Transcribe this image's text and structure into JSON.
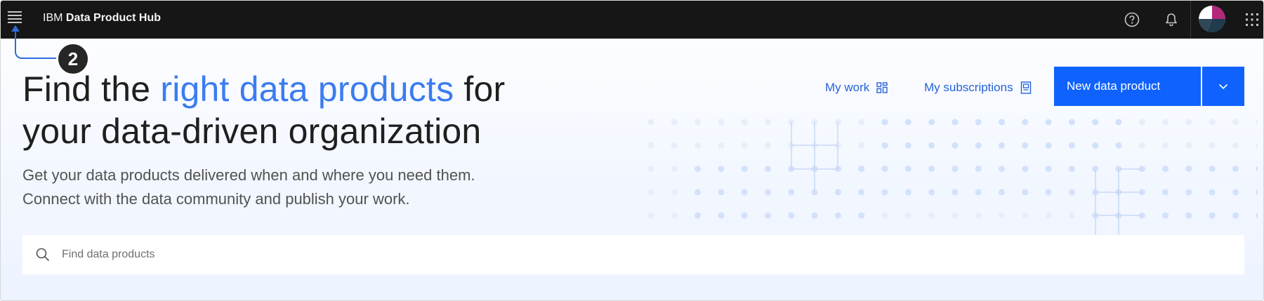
{
  "header": {
    "brand_prefix": "IBM",
    "brand_name": "Data Product Hub",
    "icons": [
      "menu-icon",
      "help-icon",
      "notification-icon",
      "avatar",
      "app-switcher-icon"
    ]
  },
  "annotation": {
    "badge": "2"
  },
  "hero": {
    "title_part1": "Find the ",
    "title_accent": "right data products",
    "title_part2": " for",
    "title_line2": "your data-driven organization",
    "subtitle_line1": "Get your data products delivered when and where you need them.",
    "subtitle_line2": "Connect with the data community and publish your work."
  },
  "actions": {
    "my_work": "My work",
    "my_subscriptions": "My subscriptions",
    "new_product": "New data product"
  },
  "search": {
    "placeholder": "Find data products",
    "value": ""
  },
  "colors": {
    "header_bg": "#161616",
    "accent_text": "#3b7cf0",
    "primary_button": "#0f62fe",
    "link": "#2563d8"
  }
}
